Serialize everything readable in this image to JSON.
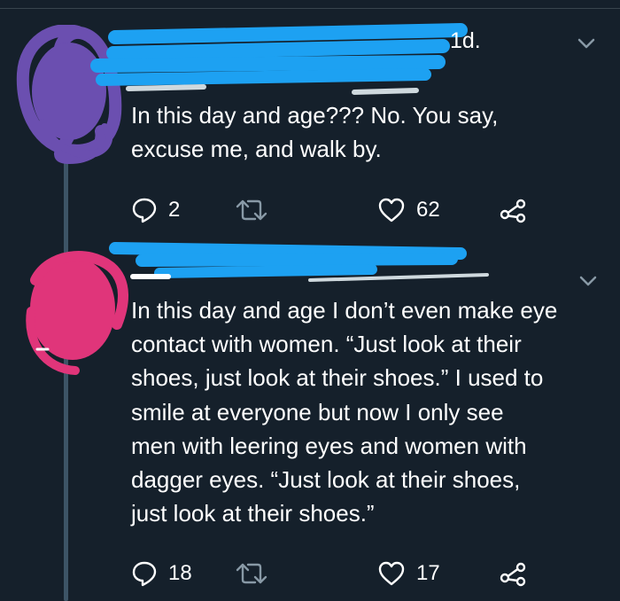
{
  "colors": {
    "background": "#15202b",
    "text": "#ffffff",
    "muted": "#8899a6",
    "redaction_blue": "#1da1f2",
    "avatar_purple": "#6b4fb0",
    "avatar_pink": "#e0357a",
    "thread_line": "#3d5466"
  },
  "tweets": [
    {
      "time": "1d.",
      "text": "In this day and age??? No. You say,\nexcuse me, and walk by.",
      "replies": "2",
      "retweets": "",
      "likes": "62",
      "icons": [
        "comment-icon",
        "retweet-icon",
        "heart-icon",
        "share-icon",
        "chevron-down-icon"
      ]
    },
    {
      "time": "",
      "text": "In this day and age I don’t even make eye\ncontact with women. “Just look at their\nshoes, just look at their shoes.” I used to\nsmile at everyone but now I only see\nmen with leering eyes and women with\ndagger eyes. “Just look at their shoes,\njust look at their shoes.”",
      "replies": "18",
      "retweets": "",
      "likes": "17",
      "icons": [
        "comment-icon",
        "retweet-icon",
        "heart-icon",
        "share-icon",
        "chevron-down-icon"
      ]
    }
  ]
}
